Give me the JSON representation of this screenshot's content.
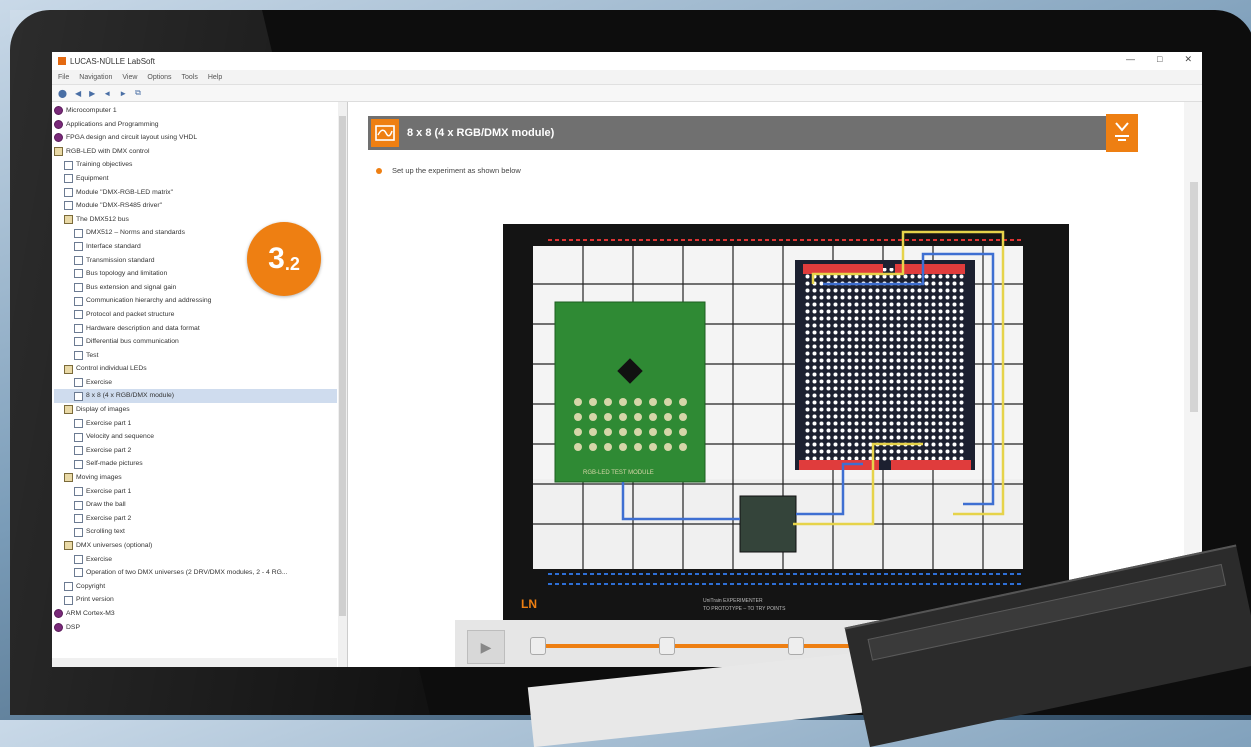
{
  "window": {
    "title": "LUCAS-NÜLLE LabSoft",
    "min": "—",
    "max": "□",
    "close": "✕"
  },
  "menu": [
    "File",
    "Navigation",
    "View",
    "Options",
    "Tools",
    "Help"
  ],
  "toolbar": [
    "⬤",
    "◀",
    "▶",
    "◄",
    "►",
    "⧉"
  ],
  "badge": {
    "main": "3",
    "sub": ".2"
  },
  "tree": [
    {
      "label": "Microcomputer 1",
      "type": "sec",
      "indent": 0
    },
    {
      "label": "Applications and Programming",
      "type": "sec",
      "indent": 0
    },
    {
      "label": "FPGA design and circuit layout using VHDL",
      "type": "sec",
      "indent": 0
    },
    {
      "label": "RGB-LED with DMX control",
      "type": "book",
      "indent": 0
    },
    {
      "label": "Training objectives",
      "type": "doc",
      "indent": 1
    },
    {
      "label": "Equipment",
      "type": "doc",
      "indent": 1
    },
    {
      "label": "Module \"DMX-RGB-LED matrix\"",
      "type": "doc",
      "indent": 1
    },
    {
      "label": "Module \"DMX-RS485 driver\"",
      "type": "doc",
      "indent": 1
    },
    {
      "label": "The DMX512 bus",
      "type": "book",
      "indent": 1
    },
    {
      "label": "DMX512 – Norms and standards",
      "type": "doc",
      "indent": 2
    },
    {
      "label": "Interface standard",
      "type": "doc",
      "indent": 2
    },
    {
      "label": "Transmission standard",
      "type": "doc",
      "indent": 2
    },
    {
      "label": "Bus topology and limitation",
      "type": "doc",
      "indent": 2
    },
    {
      "label": "Bus extension and signal gain",
      "type": "doc",
      "indent": 2
    },
    {
      "label": "Communication hierarchy and addressing",
      "type": "doc",
      "indent": 2
    },
    {
      "label": "Protocol and packet structure",
      "type": "doc",
      "indent": 2
    },
    {
      "label": "Hardware description and data format",
      "type": "doc",
      "indent": 2
    },
    {
      "label": "Differential bus communication",
      "type": "doc",
      "indent": 2
    },
    {
      "label": "Test",
      "type": "doc",
      "indent": 2
    },
    {
      "label": "Control individual LEDs",
      "type": "book",
      "indent": 1
    },
    {
      "label": "Exercise",
      "type": "doc",
      "indent": 2
    },
    {
      "label": "8 x 8 (4 x RGB/DMX module)",
      "type": "doc",
      "indent": 2,
      "selected": true
    },
    {
      "label": "Display of images",
      "type": "book",
      "indent": 1
    },
    {
      "label": "Exercise part 1",
      "type": "doc",
      "indent": 2
    },
    {
      "label": "Velocity and sequence",
      "type": "doc",
      "indent": 2
    },
    {
      "label": "Exercise part 2",
      "type": "doc",
      "indent": 2
    },
    {
      "label": "Self-made pictures",
      "type": "doc",
      "indent": 2
    },
    {
      "label": "Moving images",
      "type": "book",
      "indent": 1
    },
    {
      "label": "Exercise part 1",
      "type": "doc",
      "indent": 2
    },
    {
      "label": "Draw the ball",
      "type": "doc",
      "indent": 2
    },
    {
      "label": "Exercise part 2",
      "type": "doc",
      "indent": 2
    },
    {
      "label": "Scrolling text",
      "type": "doc",
      "indent": 2
    },
    {
      "label": "DMX universes (optional)",
      "type": "book",
      "indent": 1
    },
    {
      "label": "Exercise",
      "type": "doc",
      "indent": 2
    },
    {
      "label": "Operation of two DMX universes (2 DRV/DMX modules, 2 - 4 RG...",
      "type": "doc",
      "indent": 2
    },
    {
      "label": "Copyright",
      "type": "doc",
      "indent": 1
    },
    {
      "label": "Print version",
      "type": "doc",
      "indent": 1
    },
    {
      "label": "ARM Cortex-M3",
      "type": "sec",
      "indent": 0
    },
    {
      "label": "DSP",
      "type": "sec",
      "indent": 0
    }
  ],
  "main": {
    "heading": "8 x 8 (4 x RGB/DMX module)",
    "instruction": "Set up the experiment as shown below",
    "board_caption": "RGB-LED TEST MODULE",
    "board_foot_title": "UniTrain EXPERIMENTER",
    "board_foot_sub": "TO PROTOTYPE – TO TRY POINTS"
  },
  "player": {
    "play": "▶",
    "progress": 1.0,
    "steps": 5
  }
}
